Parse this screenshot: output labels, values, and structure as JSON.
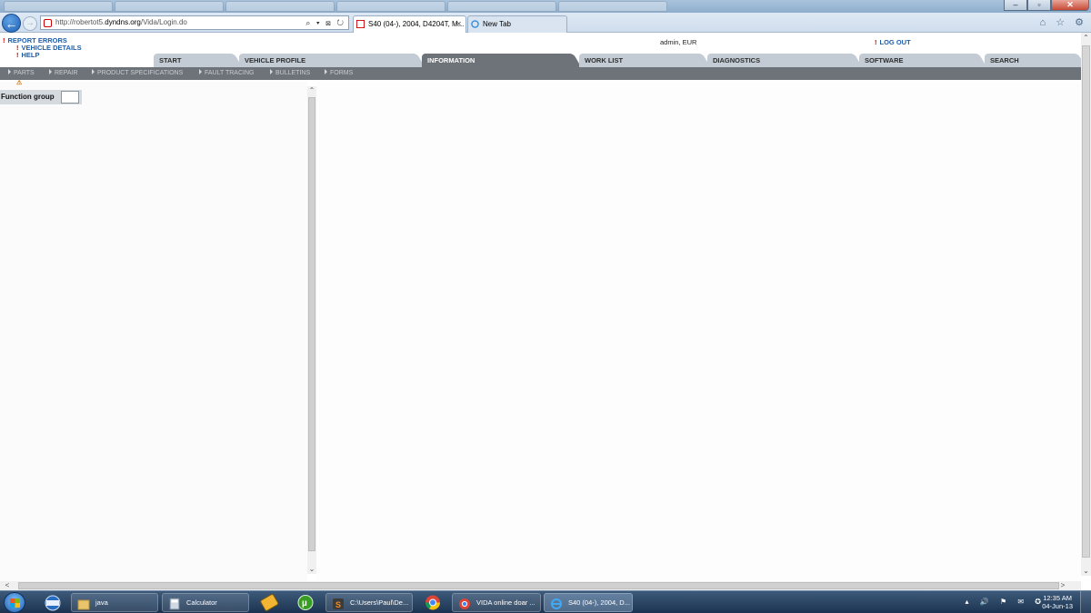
{
  "browser": {
    "address_url_prefix": "http://robertot5.",
    "address_url_domain": "dyndns.org",
    "address_url_path": "/Vida/Login.do",
    "address_icons": "⌕ ▾ ⊠ ↻",
    "tabs": [
      {
        "label": "S40 (04-), 2004, D4204T, M...",
        "active": true
      },
      {
        "label": "New Tab",
        "active": false
      }
    ],
    "toolbar_icons": "⌂ ☆ ⚙",
    "window_buttons": {
      "minimize": "–",
      "maximize": "▫",
      "close": "✕"
    }
  },
  "header": {
    "links": [
      "REPORT ERRORS",
      "VEHICLE DETAILS",
      "HELP"
    ],
    "user": "admin, EUR",
    "logout": "LOG OUT"
  },
  "main_tabs": [
    {
      "label": "START",
      "active": false
    },
    {
      "label": "VEHICLE PROFILE",
      "active": false
    },
    {
      "label": "INFORMATION",
      "active": true
    },
    {
      "label": "WORK LIST",
      "active": false
    },
    {
      "label": "DIAGNOSTICS",
      "active": false
    },
    {
      "label": "SOFTWARE",
      "active": false
    },
    {
      "label": "SEARCH",
      "active": false
    }
  ],
  "sub_nav": [
    "PARTS",
    "REPAIR",
    "PRODUCT SPECIFICATIONS",
    "FAULT TRACING",
    "BULLETINS",
    "FORMS"
  ],
  "left_panel": {
    "function_group_label": "Function group",
    "function_group_value": ""
  },
  "taskbar": {
    "items": [
      {
        "label": "java",
        "active": false
      },
      {
        "label": "Calculator",
        "active": false
      },
      {
        "label": "C:\\Users\\Paul\\De...",
        "active": false
      },
      {
        "label": "VIDA online doar ...",
        "active": false
      },
      {
        "label": "S40 (04-), 2004, D...",
        "active": true
      }
    ],
    "clock_time": "12:35 AM",
    "clock_date": "04-Jun-13"
  },
  "colors": {
    "tab_active": "#6e7379",
    "tab_inactive": "#c3ccd4",
    "link_blue": "#1f5ea8",
    "bullet_red": "#cc0000"
  }
}
